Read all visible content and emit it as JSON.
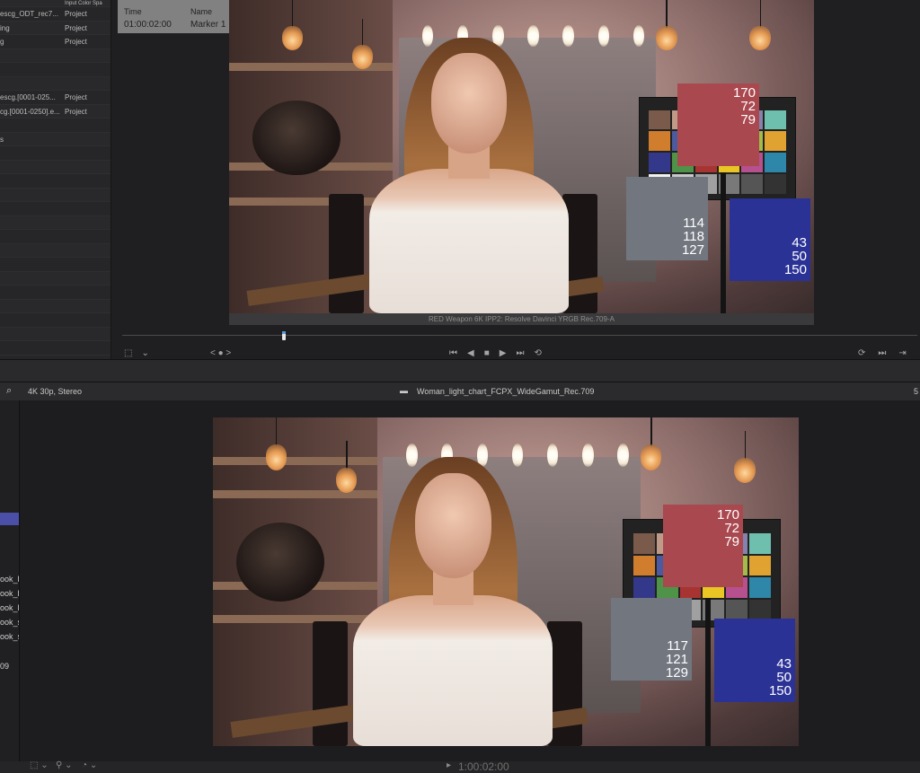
{
  "top_viewer": {
    "list_header": {
      "col2": "Input Color Spa"
    },
    "list_rows": [
      {
        "name": "escg_ODT_rec7...",
        "space": "Project"
      },
      {
        "name": "ing",
        "space": "Project"
      },
      {
        "name": "g",
        "space": "Project"
      },
      {
        "name": "",
        "space": ""
      },
      {
        "name": "",
        "space": ""
      },
      {
        "name": "",
        "space": ""
      },
      {
        "name": "escg.[0001-025...",
        "space": "Project"
      },
      {
        "name": "cg.[0001-0250].e...",
        "space": "Project"
      },
      {
        "name": "",
        "space": ""
      },
      {
        "name": "s",
        "space": ""
      },
      {
        "name": "",
        "space": ""
      },
      {
        "name": "",
        "space": ""
      },
      {
        "name": "",
        "space": ""
      },
      {
        "name": "",
        "space": ""
      },
      {
        "name": "",
        "space": ""
      },
      {
        "name": "",
        "space": ""
      },
      {
        "name": "",
        "space": ""
      },
      {
        "name": "",
        "space": ""
      },
      {
        "name": "",
        "space": ""
      },
      {
        "name": "",
        "space": ""
      },
      {
        "name": "",
        "space": ""
      },
      {
        "name": "",
        "space": ""
      },
      {
        "name": "",
        "space": ""
      },
      {
        "name": "",
        "space": ""
      },
      {
        "name": "",
        "space": ""
      }
    ],
    "marker": {
      "time_label": "Time",
      "name_label": "Name",
      "time_value": "01:00:02:00",
      "name_value": "Marker 1"
    },
    "patches": {
      "red": [
        "170",
        "72",
        "79"
      ],
      "gray": [
        "114",
        "118",
        "127"
      ],
      "blue": [
        "43",
        "50",
        "150"
      ]
    },
    "caption": "RED Weapon 6K IPP2: Resolve Davinci YRGB Rec.709-A",
    "toolbar": {
      "left_icon": "frame-select-icon",
      "chevron": "⌄",
      "nav": "< ● >",
      "transport": [
        "⏮",
        "◀",
        "■",
        "▶",
        "⏭",
        "⟲"
      ],
      "right_icons": [
        "⟳",
        "⏭",
        "⇥"
      ]
    }
  },
  "bottom_viewer": {
    "format_label": "4K 30p, Stereo",
    "clip_title": "Woman_light_chart_FCPX_WideGamut_Rec.709",
    "right_fragment": "5",
    "left_items": [
      "ook_l",
      "ook_l",
      "ook_l",
      "ook_s",
      "ook_s",
      "09"
    ],
    "patches": {
      "red": [
        "170",
        "72",
        "79"
      ],
      "gray": [
        "117",
        "121",
        "129"
      ],
      "blue": [
        "43",
        "50",
        "150"
      ]
    },
    "timecode": "1:00:02:00"
  },
  "colors": {
    "red_patch": "#aa484f",
    "gray_patch_top": "#72767f",
    "blue_patch": "#2b3296",
    "selection_blue": "#4b4fa8"
  }
}
